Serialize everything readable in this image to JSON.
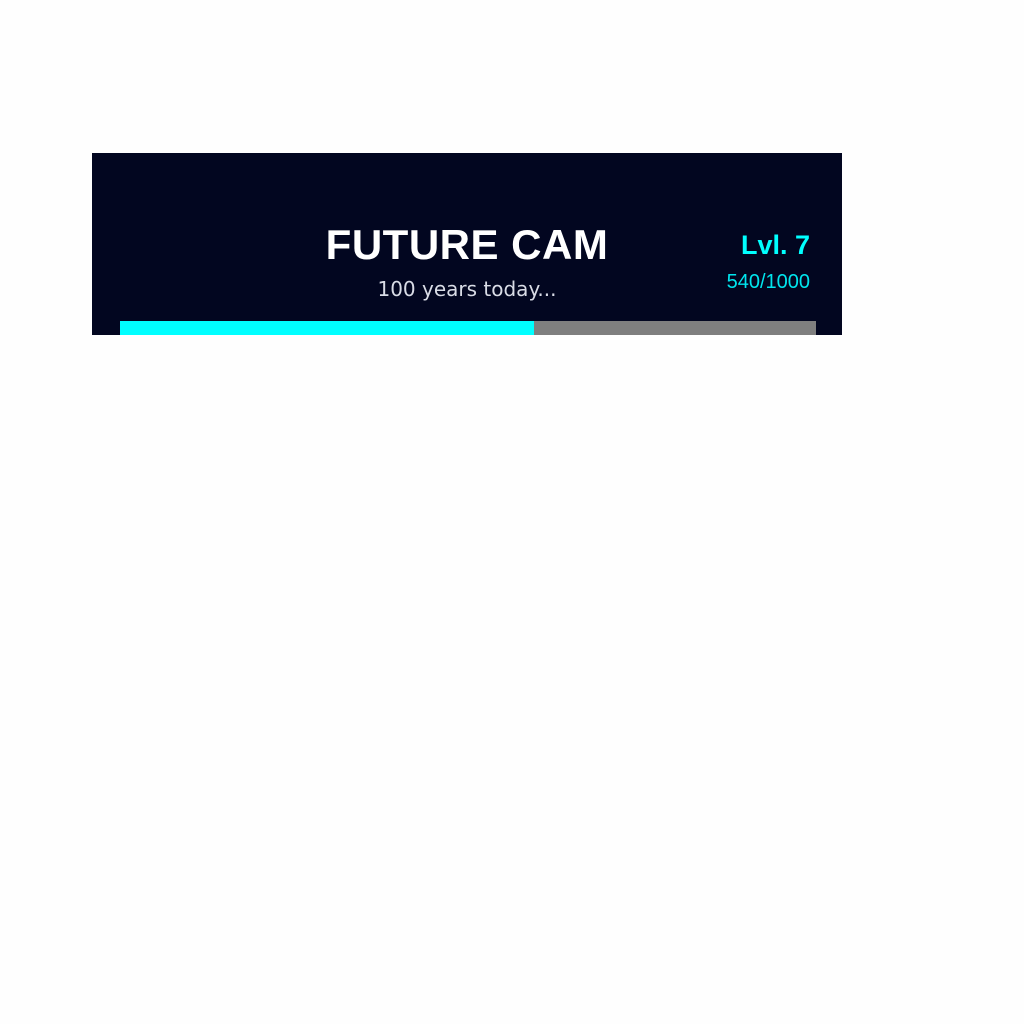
{
  "header": {
    "title": "FUTURE CAM",
    "subtitle": "100 years today..."
  },
  "level": {
    "label": "Lvl. 7",
    "xp_text": "540/1000",
    "progress_fraction": 0.595
  },
  "colors": {
    "background": "#020620",
    "accent": "#00ffff",
    "track": "#7f7f7f",
    "title_text": "#ffffff"
  }
}
